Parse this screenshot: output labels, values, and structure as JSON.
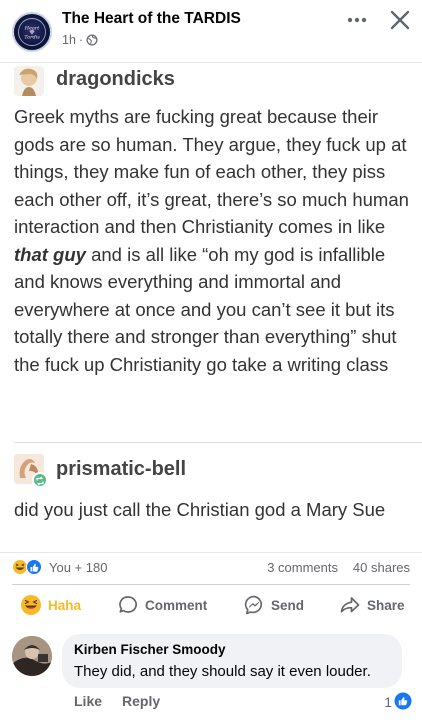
{
  "header": {
    "page_name": "The Heart of the TARDIS",
    "time_ago": "1h",
    "separator": "·",
    "avatar_text": "Heart Tardis"
  },
  "tumblr": {
    "posts": [
      {
        "username": "dragondicks",
        "text_before_em": "Greek myths are fucking great because their gods are so human. They argue, they fuck up at things, they make fun of each other, they piss each other off, it’s great, there’s so much human interaction and then Christianity comes in like ",
        "text_em": "that guy",
        "text_after_em": " and is all like “oh my god is infallible and knows everything and immortal and everywhere at once and you can’t see it but its totally there and stronger than everything” shut the fuck up Christianity go take a writing class"
      },
      {
        "username": "prismatic-bell",
        "text": "did you just call the Christian god a Mary Sue"
      }
    ]
  },
  "stats": {
    "reactions_label": "You + 180",
    "comments_label": "3 comments",
    "shares_label": "40 shares"
  },
  "actions": {
    "haha": "Haha",
    "comment": "Comment",
    "send": "Send",
    "share": "Share"
  },
  "comment": {
    "author": "Kirben Fischer Smoody",
    "text": "They did, and they should say it even louder.",
    "like": "Like",
    "reply": "Reply",
    "like_count": "1"
  },
  "colors": {
    "facebook_blue": "#1877f2",
    "haha_yellow": "#f7b928",
    "tumblr_reblog_green": "#56bc8a",
    "secondary_text": "#65676b"
  }
}
